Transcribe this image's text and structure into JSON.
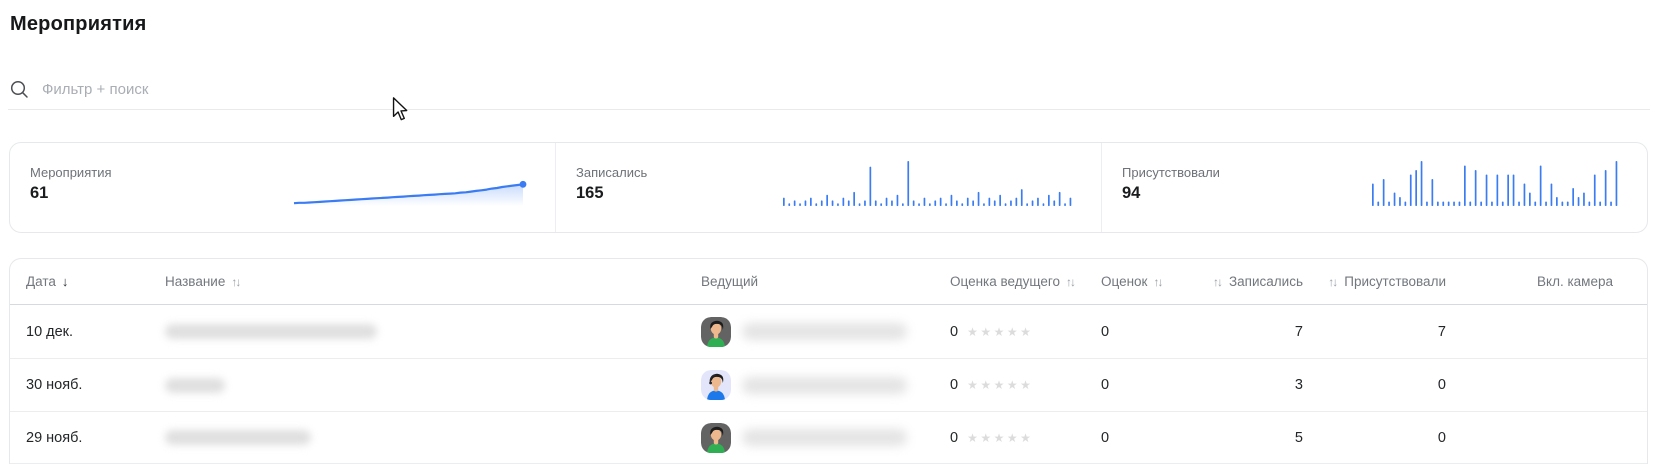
{
  "page": {
    "title": "Мероприятия"
  },
  "search": {
    "placeholder": "Фильтр + поиск"
  },
  "stats": {
    "events": {
      "label": "Мероприятия",
      "value": "61"
    },
    "signed_up": {
      "label": "Записались",
      "value": "165"
    },
    "attended": {
      "label": "Присутствовали",
      "value": "94"
    }
  },
  "chart_data": [
    {
      "type": "line",
      "title": "Мероприятия (накопительно)",
      "values": [
        4,
        5,
        5,
        6,
        7,
        8,
        9,
        10,
        11,
        12,
        13,
        14,
        15,
        16,
        17,
        18,
        19,
        20,
        21,
        22,
        23,
        24,
        25,
        26,
        27,
        28,
        29,
        30,
        31,
        32,
        33,
        34,
        36,
        37,
        39,
        41,
        43,
        45,
        48,
        50,
        53,
        55,
        57,
        59,
        61
      ],
      "ylim": [
        0,
        130
      ],
      "color": "#3b7cf2",
      "fill": "gradient-to-transparent",
      "endpoint_dot": true,
      "grid": false,
      "axes": false
    },
    {
      "type": "bar",
      "title": "Записались",
      "values": [
        3,
        1,
        2,
        1,
        2,
        3,
        1,
        2,
        4,
        2,
        1,
        3,
        2,
        5,
        1,
        2,
        14,
        2,
        1,
        3,
        2,
        4,
        1,
        16,
        2,
        1,
        3,
        1,
        2,
        3,
        1,
        4,
        2,
        1,
        3,
        2,
        5,
        1,
        3,
        2,
        4,
        1,
        2,
        3,
        6,
        1,
        2,
        3,
        1,
        4,
        2,
        5,
        1,
        3
      ],
      "color": "#3b7cf2",
      "grid": false,
      "axes": false
    },
    {
      "type": "bar",
      "title": "Присутствовали",
      "values": [
        5,
        1,
        6,
        1,
        3,
        2,
        1,
        7,
        8,
        10,
        1,
        6,
        1,
        1,
        1,
        1,
        1,
        9,
        1,
        8,
        1,
        7,
        1,
        7,
        1,
        7,
        7,
        1,
        5,
        3,
        1,
        9,
        1,
        5,
        2,
        1,
        1,
        4,
        2,
        3,
        1,
        7,
        1,
        8,
        1,
        10
      ],
      "color": "#3b7cf2",
      "grid": false,
      "axes": false
    }
  ],
  "icons": {
    "search": "magnifier",
    "sort_desc": "↓",
    "sort_both": "↑↓",
    "stars_row": "★★★★★"
  },
  "colors": {
    "accent_blue": "#3b7cf2",
    "star_empty": "#dcdcdc"
  },
  "table": {
    "columns": [
      {
        "label": "Дата",
        "sort": "desc"
      },
      {
        "label": "Название",
        "sort": "none"
      },
      {
        "label": "Ведущий",
        "sort": null
      },
      {
        "label": "Оценка ведущего",
        "sort": "none"
      },
      {
        "label": "Оценок",
        "sort": "none"
      },
      {
        "label": "Записались",
        "sort": "none",
        "sort_icon_position": "left",
        "align": "right"
      },
      {
        "label": "Присутствовали",
        "sort": "none",
        "sort_icon_position": "left",
        "align": "right"
      },
      {
        "label": "Вкл. камера",
        "sort": null,
        "align": "right"
      }
    ],
    "rows": [
      {
        "date": "10 дек.",
        "title_redacted": true,
        "host_name_redacted": true,
        "host_avatar": {
          "bg": "#636363",
          "shirt": "#2fae53"
        },
        "host_rating": "0",
        "rating_stars_filled": 0,
        "rating_stars_total": 5,
        "ratings_count": "0",
        "signed_up": "7",
        "attended": "7",
        "camera": ""
      },
      {
        "date": "30 нояб.",
        "title_redacted": true,
        "host_name_redacted": true,
        "host_avatar": {
          "bg": "#e3e6fa",
          "shirt": "#1d79e9",
          "headset": true
        },
        "host_rating": "0",
        "rating_stars_filled": 0,
        "rating_stars_total": 5,
        "ratings_count": "0",
        "signed_up": "3",
        "attended": "0",
        "camera": ""
      },
      {
        "date": "29 нояб.",
        "title_redacted": true,
        "host_name_redacted": true,
        "host_avatar": {
          "bg": "#636363",
          "shirt": "#2fae53"
        },
        "host_rating": "0",
        "rating_stars_filled": 0,
        "rating_stars_total": 5,
        "ratings_count": "0",
        "signed_up": "5",
        "attended": "0",
        "camera": ""
      }
    ]
  }
}
